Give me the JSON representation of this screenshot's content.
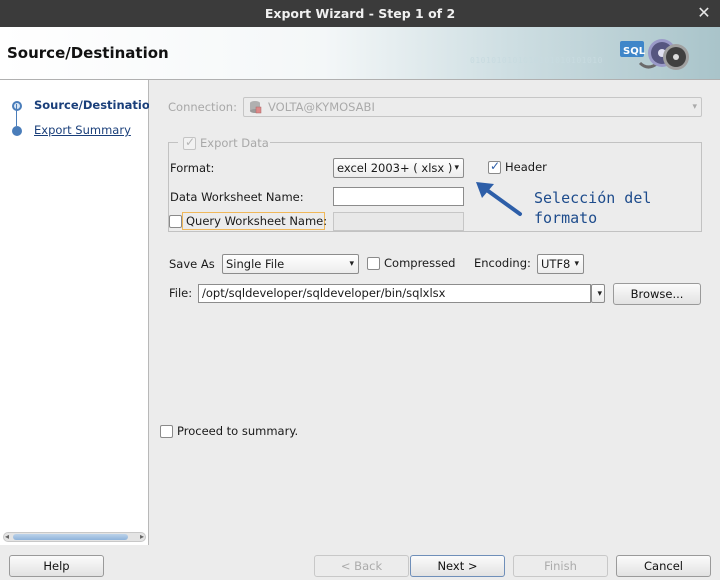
{
  "window": {
    "title": "Export Wizard - Step 1 of 2"
  },
  "banner": {
    "heading": "Source/Destination",
    "binary_text": "0101010101010101010101010",
    "logo_text": "SQL"
  },
  "nav": {
    "items": [
      {
        "label": "Source/Destination",
        "active": true
      },
      {
        "label": "Export Summary",
        "active": false
      }
    ]
  },
  "connection": {
    "label": "Connection:",
    "value": "VOLTA@KYMOSABI"
  },
  "export_data": {
    "label": "Export Data",
    "checked": true
  },
  "format": {
    "label": "Format:",
    "value": "excel 2003+ ( xlsx )"
  },
  "header": {
    "label": "Header",
    "checked": true
  },
  "data_worksheet": {
    "label": "Data Worksheet Name:",
    "value": ""
  },
  "query_worksheet": {
    "label": "Query Worksheet Name:",
    "checked": false,
    "value": ""
  },
  "annotation": {
    "line1": "Selección del",
    "line2": "formato",
    "color": "#1e4c8c"
  },
  "save_as": {
    "label": "Save As",
    "value": "Single File"
  },
  "compressed": {
    "label": "Compressed",
    "checked": false
  },
  "encoding": {
    "label": "Encoding:",
    "value": "UTF8"
  },
  "file": {
    "label": "File:",
    "value": "/opt/sqldeveloper/sqldeveloper/bin/sqlxlsx",
    "browse_label": "Browse..."
  },
  "proceed": {
    "label": "Proceed to summary.",
    "checked": false
  },
  "buttons": {
    "help": "Help",
    "back": "< Back",
    "next": "Next >",
    "finish": "Finish",
    "cancel": "Cancel"
  }
}
